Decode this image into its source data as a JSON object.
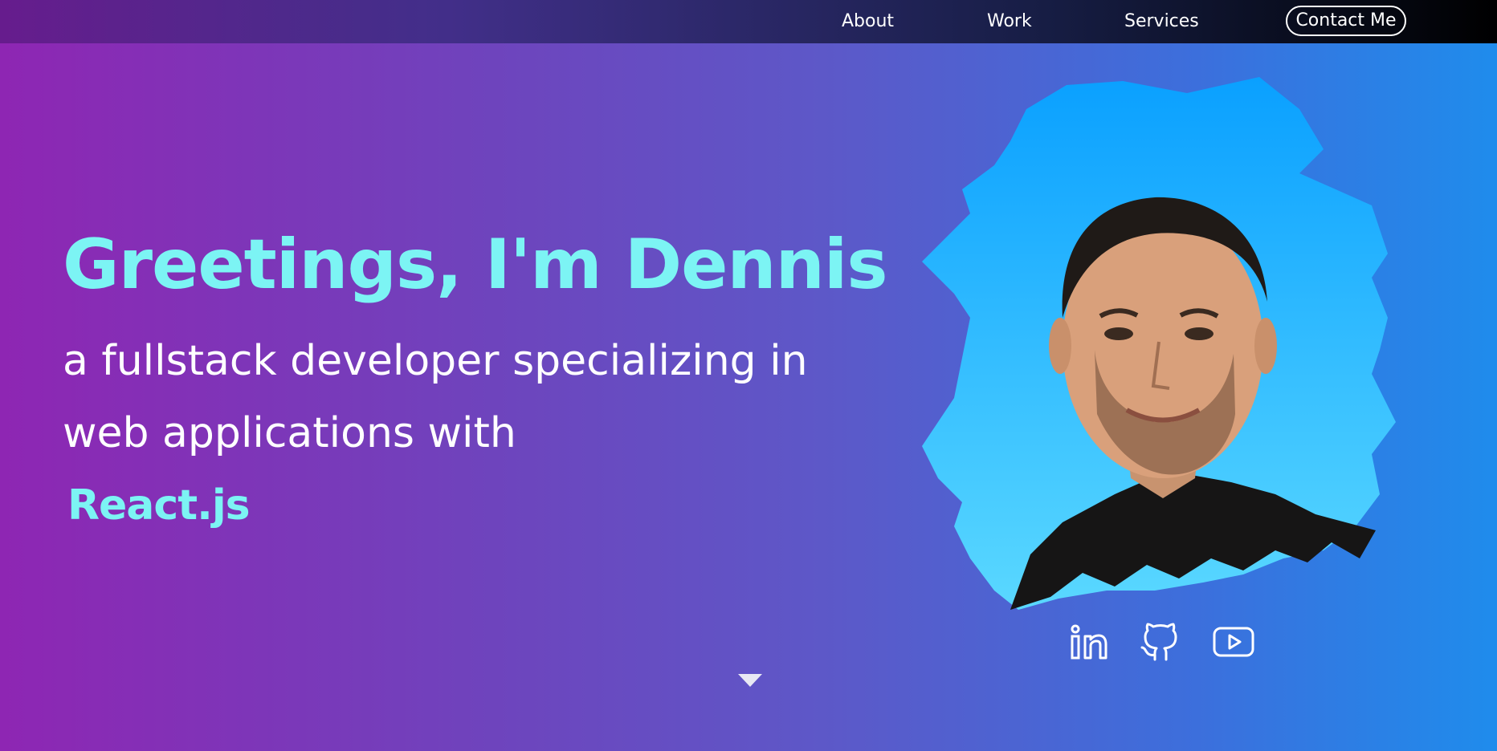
{
  "nav": {
    "about": "About",
    "work": "Work",
    "services": "Services",
    "contact": "Contact Me"
  },
  "hero": {
    "title": "Greetings, I'm Dennis",
    "line1": "a fullstack developer specializing in",
    "line2": "web applications with",
    "tech": "React.js"
  },
  "social": {
    "icons": [
      "linkedin-icon",
      "github-icon",
      "youtube-icon"
    ]
  },
  "colors": {
    "accent": "#7cf4f4",
    "bg_left": "#8e26b3",
    "bg_right": "#1f8cec",
    "nav_dark": "#000000",
    "portrait_bg": "#14b4ff"
  }
}
